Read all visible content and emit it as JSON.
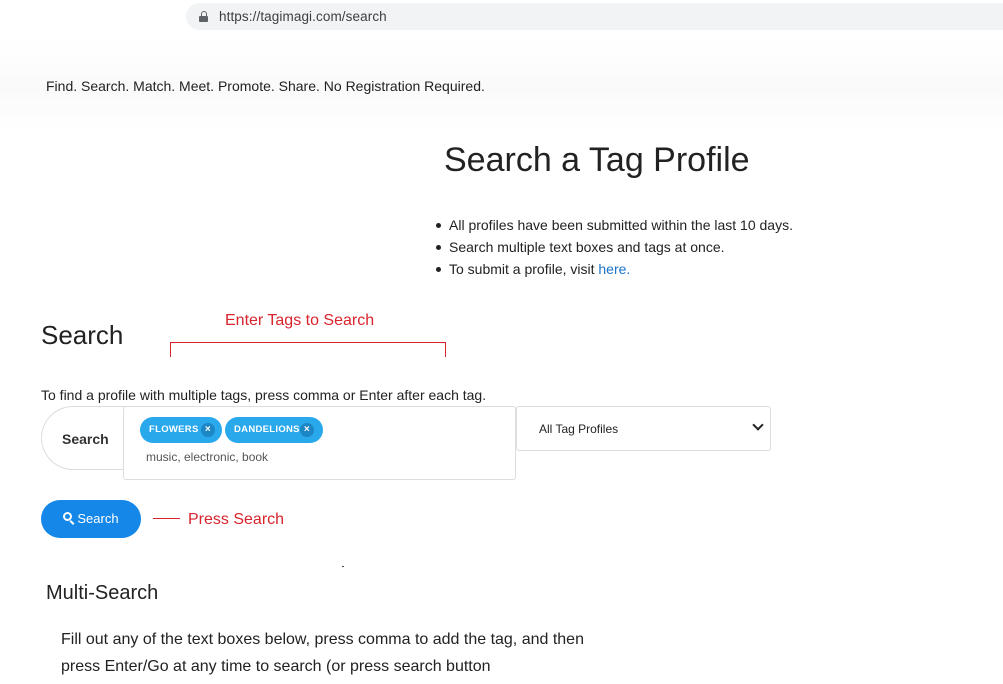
{
  "browser": {
    "url": "https://tagimagi.com/search"
  },
  "header": {
    "tagline": "Find. Search. Match. Meet. Promote. Share. No Registration Required."
  },
  "main": {
    "title": "Search a Tag Profile",
    "info": [
      "All profiles have been submitted within the last 10 days.",
      "Search multiple text boxes and tags at once.",
      "To submit a profile, visit "
    ],
    "submit_link": "here."
  },
  "search": {
    "heading": "Search",
    "instructions": "To find a profile with multiple tags, press comma or Enter after each tag.",
    "label": "Search",
    "tags": [
      {
        "text": "FLOWERS",
        "remove": "×"
      },
      {
        "text": "DANDELIONS",
        "remove": "×"
      }
    ],
    "placeholder": "music, electronic, book",
    "select_value": "All Tag Profiles",
    "button_label": "Search",
    "button_icon": "search-icon"
  },
  "annotations": {
    "enter_tags": "Enter Tags to Search",
    "press_search": "Press Search",
    "color": "#d9232d"
  },
  "multi": {
    "heading": "Multi-Search",
    "text": "Fill out any of the text boxes below, press comma to add the tag, and then press Enter/Go at any time to search (or press search button"
  },
  "colors": {
    "accent": "#1487e8",
    "chip": "#29a8ec",
    "link": "#1a73c8"
  }
}
